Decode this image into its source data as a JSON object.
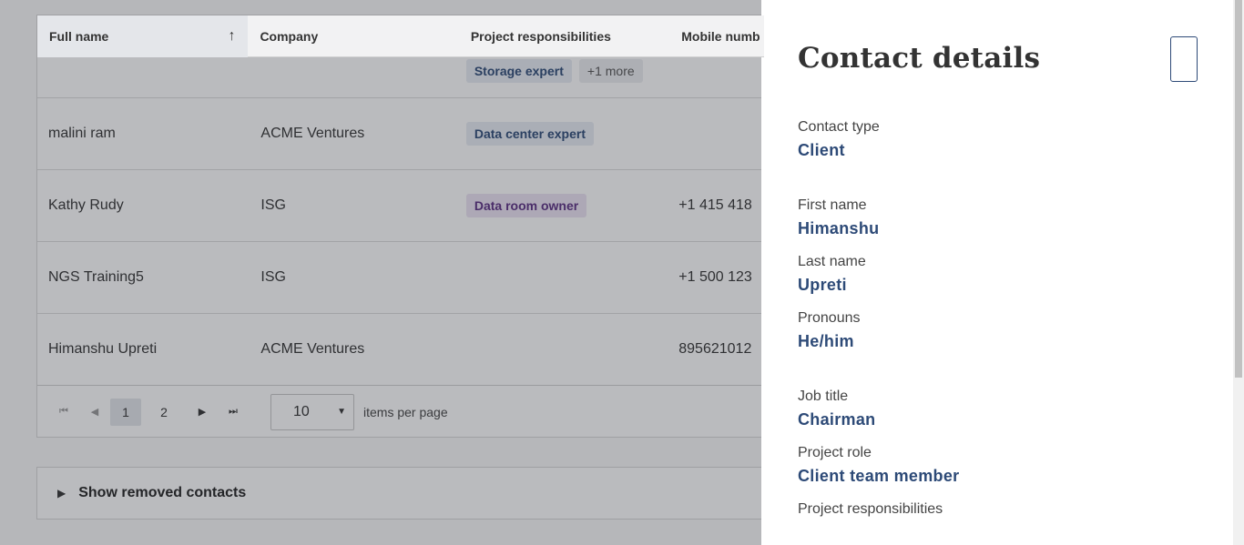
{
  "table": {
    "columns": [
      "Full name",
      "Company",
      "Project responsibilities",
      "Mobile numb"
    ],
    "rows": [
      {
        "name": "",
        "company": "",
        "tags": [
          "Storage expert"
        ],
        "more": "+1 more",
        "mobile": ""
      },
      {
        "name": "malini ram",
        "company": "ACME Ventures",
        "tags": [
          "Data center expert"
        ],
        "more": "",
        "mobile": ""
      },
      {
        "name": "Kathy Rudy",
        "company": "ISG",
        "tags": [
          "Data room owner"
        ],
        "more": "",
        "mobile": "+1 415 418"
      },
      {
        "name": "NGS Training5",
        "company": "ISG",
        "tags": [],
        "more": "",
        "mobile": "+1 500 123"
      },
      {
        "name": "Himanshu Upreti",
        "company": "ACME Ventures",
        "tags": [],
        "more": "",
        "mobile": "895621012"
      }
    ]
  },
  "pager": {
    "pages": [
      "1",
      "2"
    ],
    "current_page": "1",
    "page_size": "10",
    "items_per_page_label": "items per page"
  },
  "removed": {
    "label": "Show removed contacts"
  },
  "panel": {
    "title": "Contact details",
    "fields": {
      "contact_type": {
        "label": "Contact type",
        "value": "Client"
      },
      "first_name": {
        "label": "First name",
        "value": "Himanshu"
      },
      "last_name": {
        "label": "Last name",
        "value": "Upreti"
      },
      "pronouns": {
        "label": "Pronouns",
        "value": "He/him"
      },
      "job_title": {
        "label": "Job title",
        "value": "Chairman"
      },
      "project_role": {
        "label": "Project role",
        "value": "Client team member"
      },
      "project_responsibilities": {
        "label": "Project responsibilities",
        "value": ""
      }
    }
  },
  "colors": {
    "accent": "#2d4a77",
    "overlay": "#282c34"
  },
  "icons": {
    "sort": "arrow-up-icon",
    "first": "first-page-icon",
    "prev": "prev-page-icon",
    "next": "next-page-icon",
    "last": "last-page-icon",
    "expand": "triangle-right-icon"
  }
}
